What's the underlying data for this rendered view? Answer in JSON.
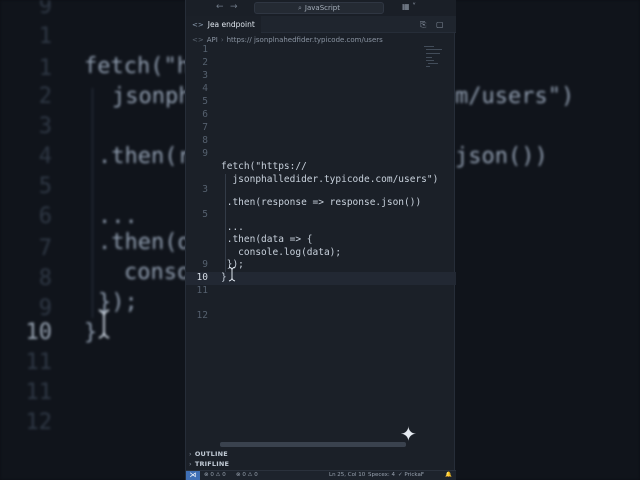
{
  "title_bar": {
    "back_icon": "arrow-left-icon",
    "forward_icon": "arrow-right-icon",
    "command_center": "JavaScript",
    "search_icon": "search-icon",
    "layout_icon": "layout-icon"
  },
  "tab": {
    "icon": "code-brackets-icon",
    "label": "Jea endpoint",
    "actions": [
      "split-editor-icon",
      "more-icon"
    ]
  },
  "breadcrumb": {
    "segments": [
      "API",
      "https:// jsonplnahedfider.typicode.com/users"
    ]
  },
  "editor": {
    "line_numbers": [
      "1",
      "2",
      "3",
      "4",
      "5",
      "6",
      "7",
      "8",
      "9",
      "10",
      "11",
      "12"
    ],
    "active_line": "10",
    "lines": {
      "l1": "fetch(\"https://",
      "l2": "  jsonphalledider.typicode.com/users\")",
      "l3": " .then(response => response.json())",
      "l4": " ...",
      "l5": " .then(data => {",
      "l6": "   console.log(data);",
      "l7": " });",
      "l8": "}"
    }
  },
  "background": {
    "line_numbers": [
      "9",
      "1",
      "2",
      "3",
      "4",
      "5",
      "6",
      "7",
      "8",
      "9",
      "10",
      "11",
      "12"
    ],
    "code": {
      "fetch": "fetch(\"h",
      "url_left": "jsonph",
      "url_right": "m/users\")",
      "then_left": ".then(r",
      "then_right": "json())",
      "dots": "...",
      "then2": ".then(d",
      "console": "conso",
      "close": "});",
      "brace": "}"
    }
  },
  "panels": {
    "outline": "OUTLINE",
    "timeline": "TRIFLINE"
  },
  "status_bar": {
    "remote_icon": "remote-icon",
    "errors": "0",
    "warnings": "0",
    "alerts": "0",
    "warnings2": "0",
    "position": "Ln 25, Col 10",
    "spaces": "Specex: 4",
    "prettier": "✓ PrickaF",
    "bell_icon": "bell-icon"
  },
  "colors": {
    "editor_bg": "#1b2028",
    "accent": "#3f6fb5"
  }
}
